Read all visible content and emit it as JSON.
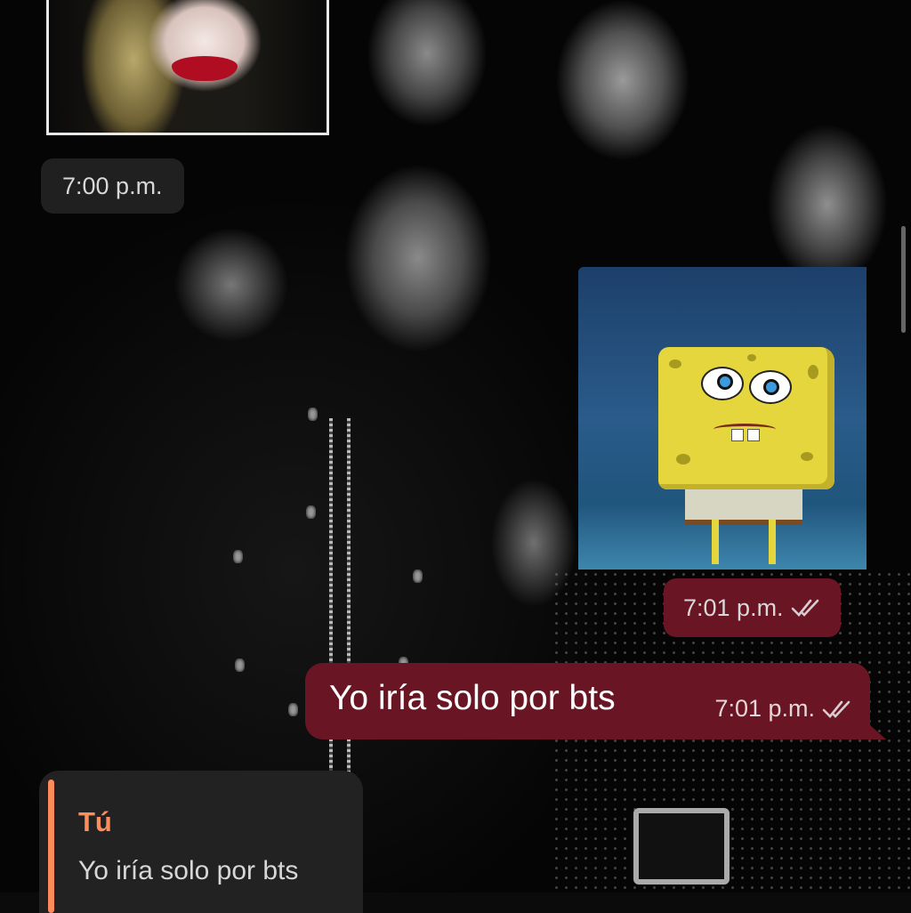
{
  "colors": {
    "outgoing_bubble": "#6a1523",
    "incoming_pill": "#232323",
    "reply_accent": "#ff8a5a",
    "text_primary": "#ffffff",
    "text_secondary": "#d8d8d8"
  },
  "messages": [
    {
      "type": "photo",
      "direction": "incoming",
      "content": "photo-thumbnail",
      "time": "7:00 p.m."
    },
    {
      "type": "sticker",
      "direction": "outgoing",
      "content": "spongebob-sticker",
      "time": "7:01 p.m.",
      "status_icon": "double-check-icon"
    },
    {
      "type": "text",
      "direction": "outgoing",
      "text": "Yo iría solo por bts",
      "time": "7:01 p.m.",
      "status_icon": "double-check-icon"
    }
  ],
  "reply_preview": {
    "sender": "Tú",
    "text": "Yo iría solo por bts"
  }
}
